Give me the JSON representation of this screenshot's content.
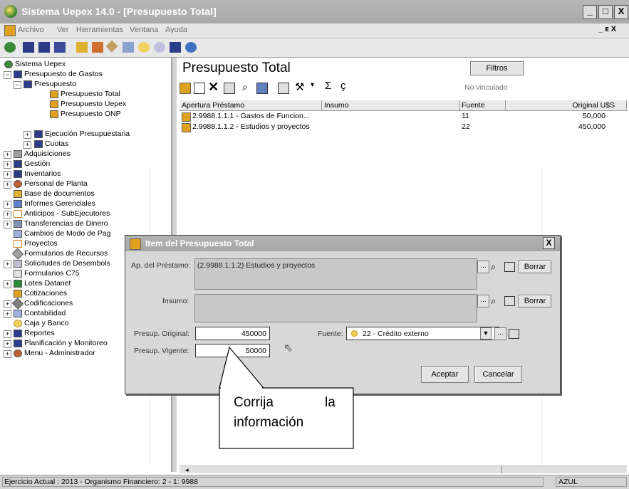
{
  "window": {
    "title": "Sistema Uepex 14.0 - [Presupuesto Total]",
    "controls": [
      "_",
      "□",
      "X"
    ],
    "mdi_controls": [
      "_",
      "ᴇ",
      "X"
    ]
  },
  "menu": [
    "Archivo",
    "Ver",
    "Herramientas",
    "Ventana",
    "Ayuda"
  ],
  "tree": {
    "root": "Sistema Uepex",
    "items": [
      "Presupuesto de Gastos",
      "Presupuesto",
      "Presupuesto Total",
      "Presupuesto Uepex",
      "Presupuesto ONP",
      "Ejecución Presupuestaria",
      "Cuotas",
      "Adquisiciones",
      "Gestión",
      "Inventarios",
      "Personal de Planta",
      "Base de documentos",
      "Informes Gerenciales",
      "Anticipos - SubEjecutores",
      "Transferencias de Dinero",
      "Cambios de Modo de Pag",
      "Proyectos",
      "Formularios de Recursos",
      "Solicitudes de Desembols",
      "Formularios C75",
      "Lotes Datanet",
      "Cotizaciones",
      "Codificaciones",
      "Contabilidad",
      "Caja y Banco",
      "Reportes",
      "Planificación y Monitoreo",
      "Menu - Administrador"
    ]
  },
  "panel": {
    "title": "Presupuesto Total",
    "filtros": "Filtros",
    "link_status": "No vinculado",
    "columns": [
      "Apertura Préstamo",
      "Insumo",
      "Fuente",
      "Original U$S"
    ],
    "rows": [
      {
        "apertura": "2.9988.1.1.1  -  Gastos de Funcion...",
        "insumo": "",
        "fuente": "11",
        "original": "50,000"
      },
      {
        "apertura": "2.9988.1.1.2  -  Estudios y proyectos",
        "insumo": "",
        "fuente": "22",
        "original": "450,000"
      }
    ]
  },
  "dialog": {
    "title": "Item del Presupuesto Total",
    "close": "X",
    "ap_label": "Ap. del Préstamo:",
    "ap_value": "(2.9988.1.1.2) Estudios y proyectos",
    "insumo_label": "Insumo:",
    "insumo_value": "",
    "borrar": "Borrar",
    "dots": "...",
    "presup_original_label": "Presup. Original:",
    "presup_original_value": "450000",
    "presup_vigente_label": "Presup. Vigente:",
    "presup_vigente_value": "50000",
    "fuente_label": "Fuente:",
    "fuente_value": "22 - Crédito externo",
    "aceptar": "Aceptar",
    "cancelar": "Cancelar"
  },
  "callout": {
    "line1_a": "Corrija",
    "line1_b": "la",
    "line2": "información"
  },
  "status": {
    "text": "Ejercicio Actual : 2013 - Organismo Financiero: 2 - 1: 9988",
    "user": "AZUL"
  }
}
